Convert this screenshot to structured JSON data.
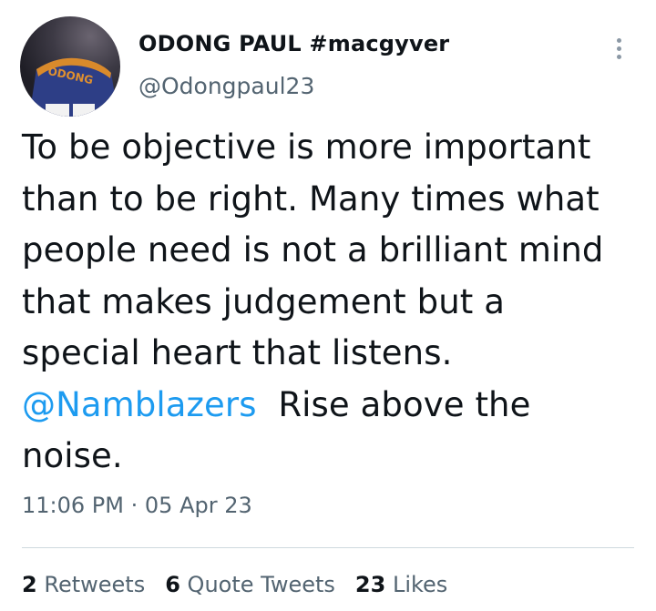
{
  "tweet": {
    "author": {
      "display_name": "ODONG PAUL #macgyver",
      "handle": "@Odongpaul23",
      "avatar_text": "ODONG"
    },
    "text_lines": [
      "To be objective is more important",
      "than to be right. Many times what",
      "people need is not a brilliant mind",
      "that makes judgement but a",
      "special heart that listens."
    ],
    "mention": "@Namblazers",
    "after_mention": "Rise above the",
    "last_line": "noise.",
    "time": "11:06 PM",
    "separator": "·",
    "date": "05 Apr 23",
    "stats": {
      "retweets": {
        "count": "2",
        "label": "Retweets"
      },
      "quote_tweets": {
        "count": "6",
        "label": "Quote Tweets"
      },
      "likes": {
        "count": "23",
        "label": "Likes"
      }
    }
  }
}
